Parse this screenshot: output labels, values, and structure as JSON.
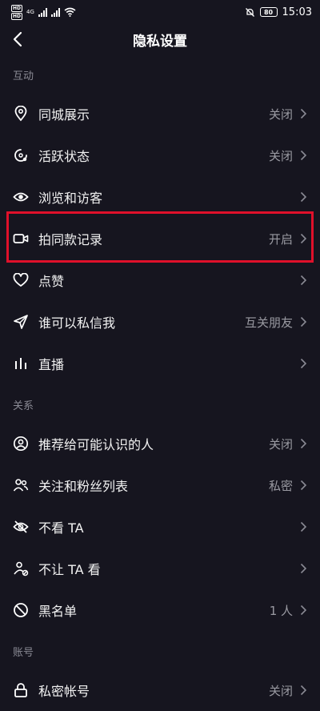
{
  "status_bar": {
    "hd1": "HD",
    "hd2": "HD",
    "net1": "4G",
    "battery": "80",
    "time": "15:03"
  },
  "nav": {
    "title": "隐私设置"
  },
  "sections": [
    {
      "header": "互动",
      "items": [
        {
          "id": "local-display",
          "icon": "location-pin-icon",
          "label": "同城展示",
          "value": "关闭"
        },
        {
          "id": "active-status",
          "icon": "activity-status-icon",
          "label": "活跃状态",
          "value": "关闭"
        },
        {
          "id": "browse-visitors",
          "icon": "eye-icon",
          "label": "浏览和访客",
          "value": ""
        },
        {
          "id": "same-style-record",
          "icon": "video-camera-icon",
          "label": "拍同款记录",
          "value": "开启"
        },
        {
          "id": "likes",
          "icon": "heart-icon",
          "label": "点赞",
          "value": ""
        },
        {
          "id": "who-can-message",
          "icon": "send-icon",
          "label": "谁可以私信我",
          "value": "互关朋友"
        },
        {
          "id": "live",
          "icon": "live-bars-icon",
          "label": "直播",
          "value": ""
        }
      ]
    },
    {
      "header": "关系",
      "items": [
        {
          "id": "recommend-to-acquaintances",
          "icon": "user-circle-icon",
          "label": "推荐给可能认识的人",
          "value": "关闭"
        },
        {
          "id": "follow-fans-list",
          "icon": "users-icon",
          "label": "关注和粉丝列表",
          "value": "私密"
        },
        {
          "id": "dont-see-ta",
          "icon": "eye-off-icon",
          "label": "不看 TA",
          "value": ""
        },
        {
          "id": "dont-let-ta-see",
          "icon": "user-block-icon",
          "label": "不让 TA 看",
          "value": ""
        },
        {
          "id": "blacklist",
          "icon": "ban-icon",
          "label": "黑名单",
          "value": "1 人"
        }
      ]
    },
    {
      "header": "账号",
      "items": [
        {
          "id": "private-account",
          "icon": "lock-icon",
          "label": "私密帐号",
          "value": "关闭"
        }
      ]
    }
  ],
  "colors": {
    "background": "#16151f",
    "text": "#f2f2f2",
    "muted": "#9a9aa2",
    "highlight_border": "#e0102a"
  }
}
